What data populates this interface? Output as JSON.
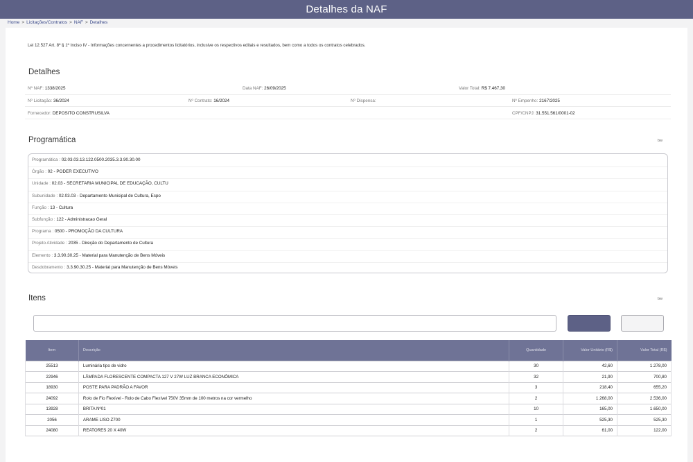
{
  "header": {
    "title": "Detalhes  da NAF"
  },
  "breadcrumb": {
    "items": [
      "Home",
      "Licitações/Contratos",
      "NAF",
      "Detalhes"
    ],
    "separator": ">"
  },
  "law_text": "Lei 12.527 Art. 8º § 1º Inciso IV - Informações concernentes a procedimentos licitatórios, inclusive os respectivos editais e resultados, bem como a todos os contratos celebrados.",
  "detalhes": {
    "title": "Detalhes",
    "naf_label": "Nº NAF:",
    "naf_value": "1338/2025",
    "data_label": "Data NAF:",
    "data_value": "26/09/2025",
    "valor_label": "Valor Total:",
    "valor_value": "R$ 7.467,30",
    "licitacao_label": "Nº Licitação:",
    "licitacao_value": "36/2024",
    "contrato_label": "Nº Contrato:",
    "contrato_value": "16/2024",
    "dispensa_label": "Nº Dispensa:",
    "dispensa_value": "",
    "empenho_label": "Nº Empenho:",
    "empenho_value": "2167/2025",
    "fornecedor_label": "Fornecedor:",
    "fornecedor_value": "DEPOSITO CONSTRUSILVA",
    "cnpj_label": "CPF/CNPJ:",
    "cnpj_value": "31.551.561/0001-02"
  },
  "programatica": {
    "title": "Programática",
    "toggle": "bw",
    "rows": [
      {
        "label": "Programática :",
        "value": "02.03.03.13.122.0500.2035.3.3.90.30.00"
      },
      {
        "label": "Órgão :",
        "value": "02 - PODER EXECUTIVO"
      },
      {
        "label": "Unidade :",
        "value": "02.03 - SECRETARIA MUNICIPAL DE EDUCAÇÃO, CULTU"
      },
      {
        "label": "Subunidade :",
        "value": "02.03.03 - Departamento Municipal de Cultura, Espo"
      },
      {
        "label": "Função :",
        "value": "13 - Cultura"
      },
      {
        "label": "Subfunção :",
        "value": "122 - Administracao Geral"
      },
      {
        "label": "Programa :",
        "value": "0500 - PROMOÇÃO DA CULTURA"
      },
      {
        "label": "Projeto Atividade :",
        "value": "2035 - Direção do Departamento de Cultura"
      },
      {
        "label": "Elemento :",
        "value": "3.3.90.30.25 - Material para Manutenção de Bens Móveis"
      },
      {
        "label": "Desdobramento :",
        "value": "3.3.90.30.25 - Material para Manutenção de Bens Móveis"
      }
    ]
  },
  "itens": {
    "title": "Itens",
    "toggle": "bw",
    "search_value": "",
    "columns": [
      "Item",
      "Descrição",
      "Quantidade",
      "Valor Unitário (R$)",
      "Valor Total (R$)"
    ],
    "rows": [
      [
        "25513",
        "Luminária tipo de vidro",
        "30",
        "42,60",
        "1.278,00"
      ],
      [
        "22946",
        "LÂMPADA FLORESCENTE COMPACTA 127 V 27W LUZ BRANCA ECONÔMICA",
        "32",
        "21,90",
        "700,80"
      ],
      [
        "18930",
        "POSTE PARA PADRÃO A FAVOR",
        "3",
        "218,40",
        "655,20"
      ],
      [
        "24092",
        "Rolo de Fio Flexível - Rolo de Cabo Flexível 750V 35mm de 100 metros na cor vermelho",
        "2",
        "1.268,00",
        "2.536,00"
      ],
      [
        "13928",
        "BRITA Nº01",
        "10",
        "165,00",
        "1.650,00"
      ],
      [
        "2056",
        "ARAME LISO Z700",
        "1",
        "525,30",
        "525,30"
      ],
      [
        "24080",
        "REATORES 20 X 40W",
        "2",
        "61,00",
        "122,00"
      ]
    ]
  }
}
